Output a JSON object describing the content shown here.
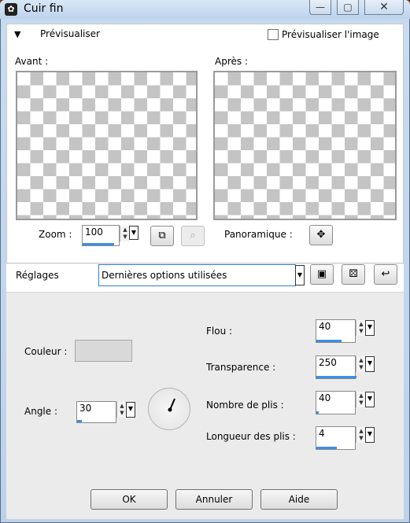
{
  "window": {
    "title": "Cuir fin",
    "minimize_glyph": "—",
    "maximize_glyph": "▢",
    "close_glyph": "✕"
  },
  "preview": {
    "section_title": "Prévisualiser",
    "toggle_glyph": "▼",
    "preview_image_label": "Prévisualiser l'image",
    "preview_image_checked": false,
    "before_label": "Avant :",
    "after_label": "Après :",
    "zoom_label": "Zoom :",
    "zoom_value": "100",
    "pan_label": "Panoramique :"
  },
  "settings": {
    "label": "Réglages",
    "selected": "Dernières options utilisées"
  },
  "params": {
    "color_label": "Couleur :",
    "color_value": "#d9d9d9",
    "angle_label": "Angle :",
    "angle_value": "30",
    "blur_label": "Flou :",
    "blur_value": "40",
    "transparency_label": "Transparence :",
    "transparency_value": "250",
    "folds_label": "Nombre de plis :",
    "folds_value": "40",
    "fold_length_label": "Longueur des plis :",
    "fold_length_value": "4"
  },
  "buttons": {
    "ok": "OK",
    "cancel": "Annuler",
    "help": "Aide"
  },
  "icons": {
    "zoom_fit": "fit-to-window-icon",
    "zoom_tool": "zoom-tool-icon",
    "pan": "move-cross-icon",
    "save": "floppy-disk-icon",
    "randomize": "dice-icon",
    "reset": "reset-arrow-icon"
  }
}
